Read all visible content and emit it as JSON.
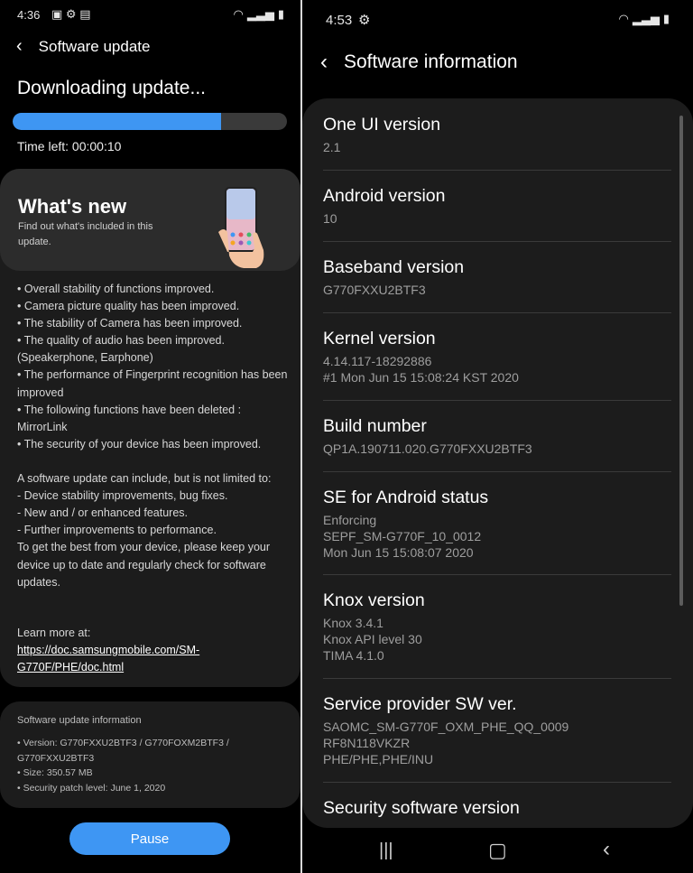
{
  "left": {
    "status": {
      "time": "4:36"
    },
    "header": {
      "title": "Software update"
    },
    "download": {
      "title": "Downloading update...",
      "progress_fraction": 0.76,
      "time_left": "Time left: 00:00:10"
    },
    "whats_new": {
      "title": "What's new",
      "subtitle": "Find out what's included in this update.",
      "notes": [
        "• Overall stability of functions improved.",
        "• Camera picture quality has been improved.",
        "• The stability of Camera has been improved.",
        "• The quality of audio has been improved.",
        "(Speakerphone, Earphone)",
        "• The performance of Fingerprint recognition has been improved",
        "• The following functions have been deleted : MirrorLink",
        "• The security of your device has been improved.",
        "",
        "A software update can include, but is not limited to:",
        " - Device stability improvements, bug fixes.",
        " - New and / or enhanced features.",
        " - Further improvements to performance.",
        "To get the best from your device, please keep your device up to date and regularly check for software updates."
      ],
      "learn_more_label": "Learn more at:",
      "learn_more_link": "https://doc.samsungmobile.com/SM-G770F/PHE/doc.html"
    },
    "update_info": {
      "title": "Software update information",
      "version": "• Version: G770FXXU2BTF3 / G770FOXM2BTF3 / G770FXXU2BTF3",
      "size": "• Size: 350.57 MB",
      "patch": "• Security patch level: June 1, 2020"
    },
    "pause_label": "Pause"
  },
  "right": {
    "status": {
      "time": "4:53"
    },
    "header": {
      "title": "Software information"
    },
    "rows": [
      {
        "label": "One UI version",
        "values": [
          "2.1"
        ]
      },
      {
        "label": "Android version",
        "values": [
          "10"
        ]
      },
      {
        "label": "Baseband version",
        "values": [
          "G770FXXU2BTF3"
        ]
      },
      {
        "label": "Kernel version",
        "values": [
          "4.14.117-18292886",
          "#1 Mon Jun 15 15:08:24 KST 2020"
        ]
      },
      {
        "label": "Build number",
        "values": [
          "QP1A.190711.020.G770FXXU2BTF3"
        ]
      },
      {
        "label": "SE for Android status",
        "values": [
          "Enforcing",
          "SEPF_SM-G770F_10_0012",
          "Mon Jun 15 15:08:07 2020"
        ]
      },
      {
        "label": "Knox version",
        "values": [
          "Knox 3.4.1",
          "Knox API level 30",
          "TIMA 4.1.0"
        ]
      },
      {
        "label": "Service provider SW ver.",
        "values": [
          "SAOMC_SM-G770F_OXM_PHE_QQ_0009",
          "RF8N118VKZR",
          "PHE/PHE,PHE/INU"
        ]
      },
      {
        "label": "Security software version",
        "values": []
      }
    ]
  },
  "icons": {
    "left_status": [
      "image-icon",
      "gear-icon",
      "download-icon",
      "wifi-icon",
      "signal-icon",
      "battery-icon"
    ],
    "right_status": [
      "gear-icon",
      "wifi-icon",
      "signal-icon",
      "battery-icon"
    ],
    "nav": [
      "recents-icon",
      "home-icon",
      "back-icon"
    ]
  },
  "colors": {
    "accent": "#3e96f3",
    "card": "#1c1c1c",
    "background": "#000000"
  }
}
